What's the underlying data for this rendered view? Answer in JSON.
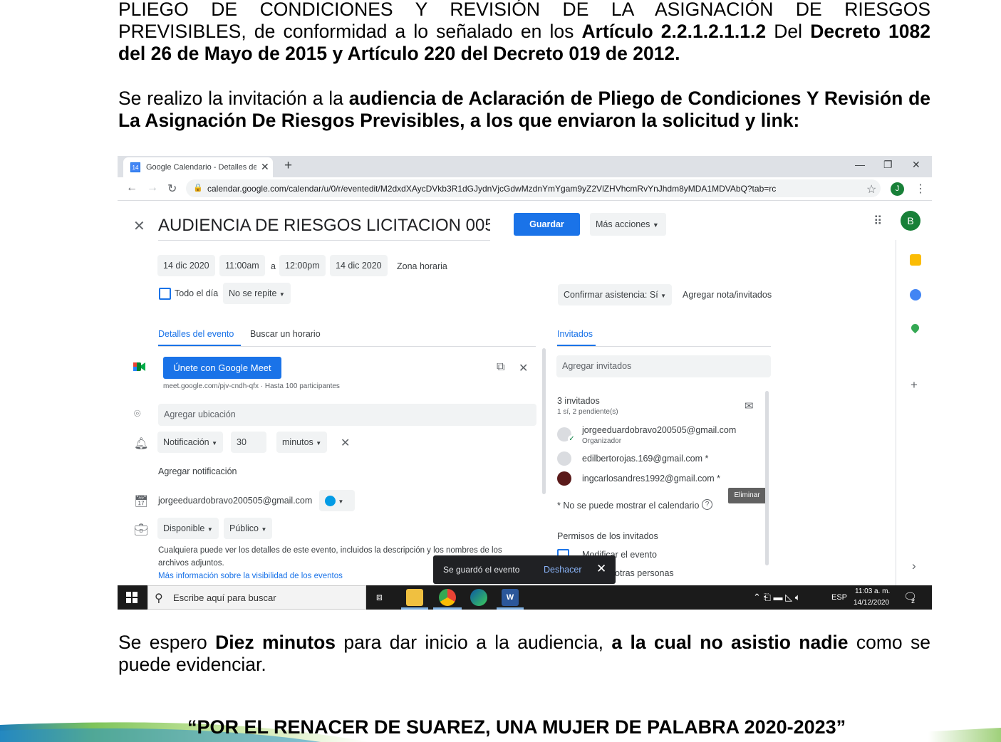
{
  "document": {
    "p1": {
      "l1": "PLIEGO DE CONDICIONES Y REVISIÓN DE LA ASIGNACIÓN DE RIESGOS",
      "l2a": "PREVISIBLES,",
      "l2b": " de conformidad a lo señalado en los ",
      "l2c": "Artículo 2.2.1.2.1.1.2",
      "l2d": " Del ",
      "l2e": "Decreto 1082",
      "l3": "del 26 de Mayo de 2015 y Artículo 220 del Decreto 019 de 2012."
    },
    "p2": {
      "a": "Se realizo la invitación a la ",
      "b": "audiencia de Aclaración de Pliego de Condiciones Y Revisión de La Asignación De Riesgos Previsibles, a los que enviaron la solicitud y link:"
    },
    "p3": {
      "a": "Se espero ",
      "b": "Diez minutos",
      "c": " para dar inicio a la audiencia, ",
      "d": "a la cual no asistio nadie",
      "e": " como se puede evidenciar."
    },
    "footer": "“POR EL RENACER DE SUAREZ, UNA MUJER DE PALABRA 2020-2023”"
  },
  "browser": {
    "tab_title": "Google Calendario - Detalles del",
    "tab_fav": "14",
    "url": "calendar.google.com/calendar/u/0/r/eventedit/M2dxdXAycDVkb3R1dGJydnVjcGdwMzdnYmYgam9yZ2VlZHVhcmRvYnJhdm8yMDA1MDVAbQ?tab=rc",
    "profile": "J"
  },
  "calendar": {
    "title": "AUDIENCIA DE RIESGOS LICITACION 005",
    "save": "Guardar",
    "more_actions": "Más acciones",
    "avatar": "B",
    "start_date": "14 dic 2020",
    "start_time": "11:00am",
    "to": "a",
    "end_time": "12:00pm",
    "end_date": "14 dic 2020",
    "timezone": "Zona horaria",
    "all_day": "Todo el día",
    "repeat": "No se repite",
    "rsvp": "Confirmar asistencia: Sí",
    "add_note": "Agregar nota/invitados",
    "tab_details": "Detalles del evento",
    "tab_find": "Buscar un horario",
    "tab_guests": "Invitados",
    "meet_button": "Únete con Google Meet",
    "meet_info": "meet.google.com/pjv-cndh-qfx · Hasta 100 participantes",
    "location": "Agregar ubicación",
    "notification": "Notificación",
    "notif_value": "30",
    "notif_unit": "minutos",
    "add_notification": "Agregar notificación",
    "calendar_owner": "jorgeeduardobravo200505@gmail.com",
    "availability": "Disponible",
    "visibility": "Público",
    "visibility_note_1": "Cualquiera puede ver los detalles de este evento, incluidos la descripción y los nombres de los",
    "visibility_note_2": "archivos adjuntos.",
    "visibility_link": "Más información sobre la visibilidad de los eventos",
    "add_guests": "Agregar invitados",
    "guest_count": "3 invitados",
    "guest_status": "1 sí, 2 pendiente(s)",
    "guests": [
      {
        "email": "jorgeeduardobravo200505@gmail.com",
        "role": "Organizador"
      },
      {
        "email": "edilbertorojas.169@gmail.com *"
      },
      {
        "email": "ingcarlosandres1992@gmail.com *"
      }
    ],
    "remove_tooltip": "Eliminar",
    "calendar_note": "* No se puede mostrar el calendario",
    "permissions": "Permisos de los invitados",
    "perm_modify": "el evento",
    "perm_invite": "otras personas",
    "modify_cut": "Modificar",
    "snackbar_msg": "Se guardó el evento",
    "snackbar_undo": "Deshacer"
  },
  "taskbar": {
    "search": "Escribe aquí para buscar",
    "lang": "ESP",
    "time": "11:03 a. m.",
    "date": "14/12/2020",
    "notif_count": "2"
  },
  "colors": {
    "primary": "#1a73e8",
    "event_color": "#039be5",
    "meet_green": "#00832d"
  }
}
